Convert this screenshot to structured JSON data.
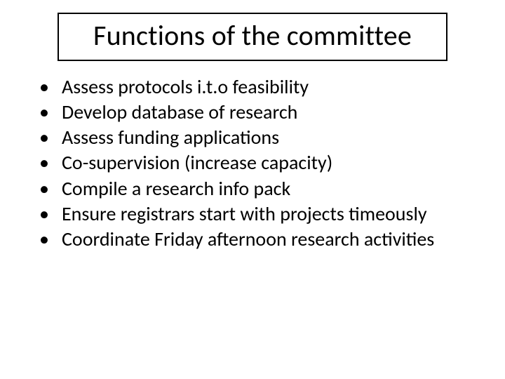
{
  "slide": {
    "title": "Functions of the committee",
    "bullets": [
      "Assess protocols i.t.o feasibility",
      "Develop database of research",
      "Assess funding applications",
      "Co-supervision (increase capacity)",
      "Compile a research info pack",
      "Ensure registrars start with projects timeously",
      "Coordinate Friday afternoon research activities"
    ]
  }
}
